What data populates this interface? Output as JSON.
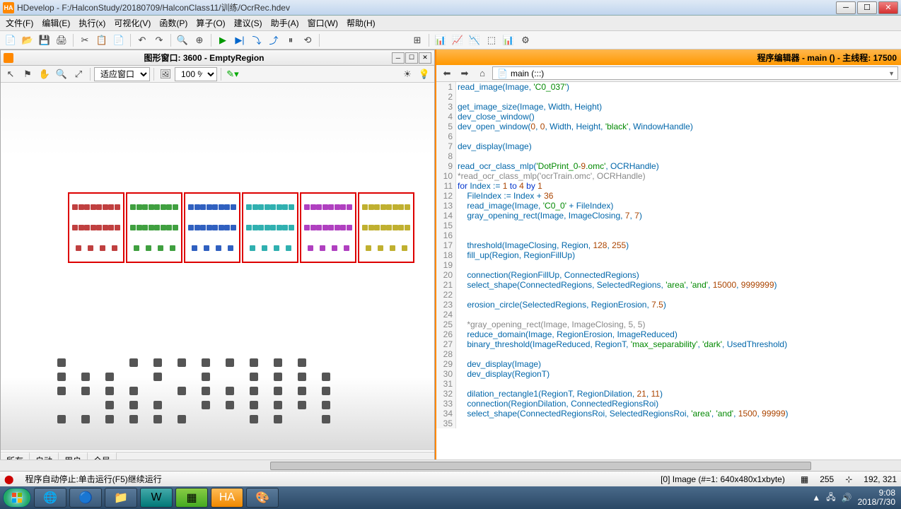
{
  "window": {
    "app_icon_text": "HA",
    "title": "HDevelop - F:/HalconStudy/20180709/HalconClass11/训练/OcrRec.hdev"
  },
  "menu": [
    "文件(F)",
    "编辑(E)",
    "执行(x)",
    "可视化(V)",
    "函数(P)",
    "算子(O)",
    "建议(S)",
    "助手(A)",
    "窗口(W)",
    "帮助(H)"
  ],
  "gfx": {
    "title": "图形窗口: 3600 - EmptyRegion",
    "fit_label": "适应窗口",
    "zoom": "100 %",
    "tabs": [
      "所有",
      "自动",
      "用户",
      "全局"
    ]
  },
  "editor": {
    "title": "程序编辑器 - main () - 主线程: 17500",
    "nav_field": "main (:::)"
  },
  "code": [
    {
      "n": 1,
      "t": "read_image(Image, 'C0_037')"
    },
    {
      "n": 2,
      "t": ""
    },
    {
      "n": 3,
      "t": "get_image_size(Image, Width, Height)"
    },
    {
      "n": 4,
      "t": "dev_close_window()"
    },
    {
      "n": 5,
      "t": "dev_open_window(0, 0, Width, Height, 'black', WindowHandle)"
    },
    {
      "n": 6,
      "t": ""
    },
    {
      "n": 7,
      "t": "dev_display(Image)"
    },
    {
      "n": 8,
      "t": ""
    },
    {
      "n": 9,
      "t": "read_ocr_class_mlp('DotPrint_0-9.omc', OCRHandle)"
    },
    {
      "n": 10,
      "t": "*read_ocr_class_mlp('ocrTrain.omc', OCRHandle)",
      "c": true
    },
    {
      "n": 11,
      "t": "for Index := 1 to 4 by 1"
    },
    {
      "n": 12,
      "t": "    FileIndex := Index + 36"
    },
    {
      "n": 13,
      "t": "    read_image(Image, 'C0_0' + FileIndex)"
    },
    {
      "n": 14,
      "t": "    gray_opening_rect(Image, ImageClosing, 7, 7)"
    },
    {
      "n": 15,
      "t": ""
    },
    {
      "n": 16,
      "t": ""
    },
    {
      "n": 17,
      "t": "    threshold(ImageClosing, Region, 128, 255)"
    },
    {
      "n": 18,
      "t": "    fill_up(Region, RegionFillUp)"
    },
    {
      "n": 19,
      "t": ""
    },
    {
      "n": 20,
      "t": "    connection(RegionFillUp, ConnectedRegions)"
    },
    {
      "n": 21,
      "t": "    select_shape(ConnectedRegions, SelectedRegions, 'area', 'and', 15000, 9999999)"
    },
    {
      "n": 22,
      "t": ""
    },
    {
      "n": 23,
      "t": "    erosion_circle(SelectedRegions, RegionErosion, 7.5)"
    },
    {
      "n": 24,
      "t": ""
    },
    {
      "n": 25,
      "t": "    *gray_opening_rect(Image, ImageClosing, 5, 5)",
      "c": true
    },
    {
      "n": 26,
      "t": "    reduce_domain(Image, RegionErosion, ImageReduced)"
    },
    {
      "n": 27,
      "t": "    binary_threshold(ImageReduced, RegionT, 'max_separability', 'dark', UsedThreshold)"
    },
    {
      "n": 28,
      "t": ""
    },
    {
      "n": 29,
      "t": "    dev_display(Image)"
    },
    {
      "n": 30,
      "t": "    dev_display(RegionT)"
    },
    {
      "n": 31,
      "t": ""
    },
    {
      "n": 32,
      "t": "    dilation_rectangle1(RegionT, RegionDilation, 21, 11)"
    },
    {
      "n": 33,
      "t": "    connection(RegionDilation, ConnectedRegionsRoi)"
    },
    {
      "n": 34,
      "t": "    select_shape(ConnectedRegionsRoi, SelectedRegionsRoi, 'area', 'and', 1500, 99999)"
    },
    {
      "n": 35,
      "t": ""
    }
  ],
  "status": {
    "left": "程序自动停止:单击运行(F5)继续运行",
    "image_info": "[0] Image (#=1: 640x480x1xbyte)",
    "gray_icon_val": "255",
    "coords": "192, 321"
  },
  "tray": {
    "time": "9:08",
    "date": "2018/7/30"
  },
  "region_colors": [
    "#c04040",
    "#40a040",
    "#3060c0",
    "#30b0b0",
    "#b040c0",
    "#c0b030"
  ]
}
